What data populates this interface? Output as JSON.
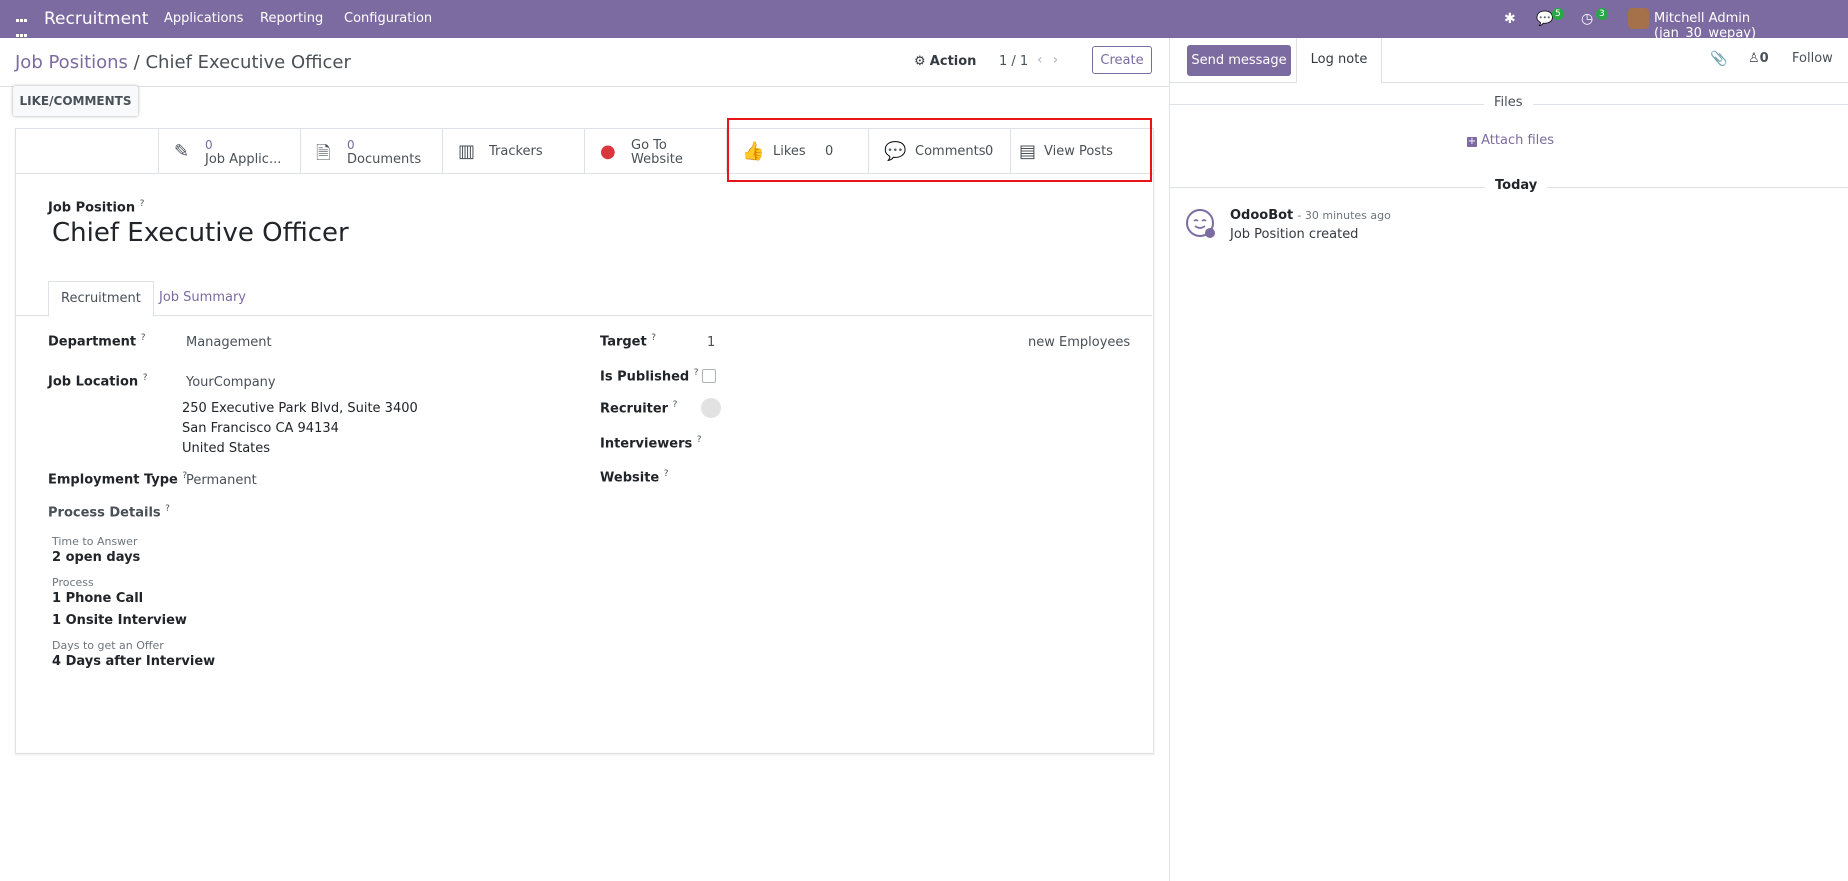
{
  "topbar": {
    "brand": "Recruitment",
    "menu": [
      "Applications",
      "Reporting",
      "Configuration"
    ],
    "messages_count": "5",
    "activities_count": "3",
    "user": "Mitchell Admin (jan_30_wepay)"
  },
  "control": {
    "breadcrumb_parent": "Job Positions",
    "breadcrumb_sep": "/",
    "breadcrumb_current": "Chief Executive Officer",
    "action_label": "Action",
    "pager": "1 / 1",
    "create_label": "Create"
  },
  "like_comments_button": "LIKE/COMMENTS",
  "stats": {
    "applications_count": "0",
    "applications_label": "Job Applic...",
    "documents_count": "0",
    "documents_label": "Documents",
    "trackers_label": "Trackers",
    "website_label_1": "Go To",
    "website_label_2": "Website",
    "likes_label": "Likes",
    "likes_count": "0",
    "comments_label": "Comments",
    "comments_count": "0",
    "view_posts_label": "View Posts"
  },
  "form": {
    "job_position_label": "Job Position",
    "job_title": "Chief Executive Officer",
    "tabs": [
      "Recruitment",
      "Job Summary"
    ],
    "department_label": "Department",
    "department": "Management",
    "job_location_label": "Job Location",
    "job_location": "YourCompany",
    "address_line1": "250 Executive Park Blvd, Suite 3400",
    "address_line2": "San Francisco CA 94134",
    "address_line3": "United States",
    "employment_type_label": "Employment Type",
    "employment_type": "Permanent",
    "process_details_label": "Process Details",
    "time_to_answer_label": "Time to Answer",
    "time_to_answer": "2 open days",
    "process_label": "Process",
    "process_step1": "1 Phone Call",
    "process_step2": "1 Onsite Interview",
    "days_offer_label": "Days to get an Offer",
    "days_offer": "4 Days after Interview",
    "target_label": "Target",
    "target": "1",
    "target_suffix": "new Employees",
    "is_published_label": "Is Published",
    "recruiter_label": "Recruiter",
    "interviewers_label": "Interviewers",
    "website_label": "Website",
    "help_mark": "?"
  },
  "chatter": {
    "send_message": "Send message",
    "log_note": "Log note",
    "followers_count": "0",
    "follow_label": "Follow",
    "files_title": "Files",
    "attach_files": "Attach files",
    "today": "Today",
    "author": "OdooBot",
    "time": "- 30 minutes ago",
    "message": "Job Position created"
  }
}
